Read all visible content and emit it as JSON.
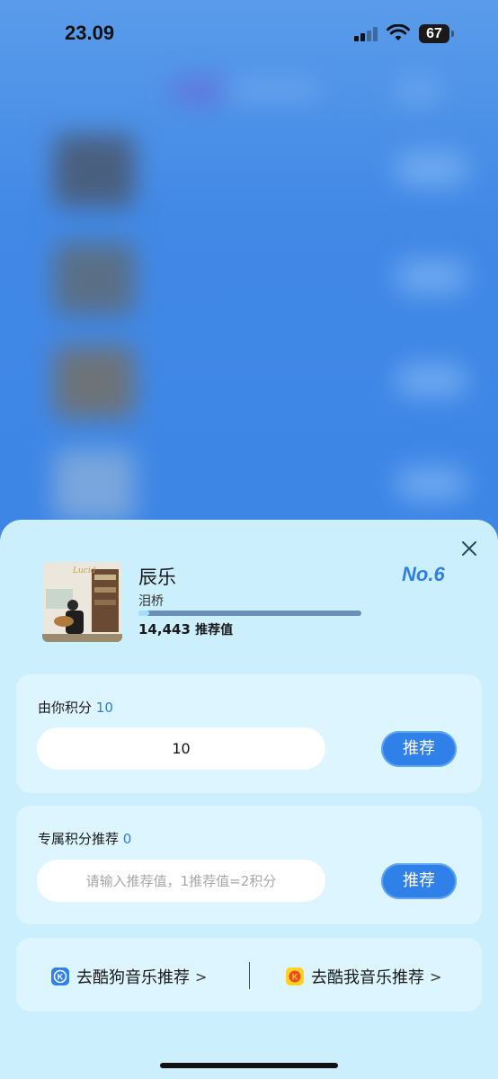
{
  "status_bar": {
    "time": "23.09",
    "battery": "67"
  },
  "sheet": {
    "close_icon": "close-icon",
    "song": {
      "title": "辰乐",
      "artist": "泪桥",
      "rank": "No.6",
      "score_value": "14,443",
      "score_label": "推荐值",
      "progress_fraction": 0.05,
      "cover_text": "Lucid"
    },
    "points_card": {
      "label": "由你积分",
      "points": "10",
      "input_value": "10",
      "button": "推荐"
    },
    "exclusive_card": {
      "label": "专属积分推荐",
      "points": "0",
      "input_placeholder": "请输入推荐值，1推荐值=2积分",
      "button": "推荐"
    },
    "links": {
      "kugou": "去酷狗音乐推荐",
      "kuwo": "去酷我音乐推荐",
      "chevron": ">"
    }
  },
  "colors": {
    "accent": "#2f80e8",
    "sheet_bg": "#cbeffd",
    "card_bg": "#ddf5fe",
    "rank": "#2f7fe6"
  }
}
